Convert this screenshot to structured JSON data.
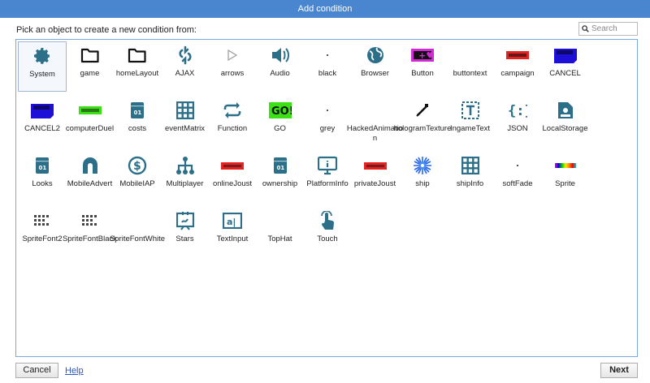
{
  "dialog": {
    "title": "Add condition",
    "prompt": "Pick an object to create a new condition from:",
    "search_placeholder": "Search"
  },
  "objects": [
    {
      "label": "System",
      "icon": "gear-icon",
      "selected": true
    },
    {
      "label": "game",
      "icon": "folder-icon"
    },
    {
      "label": "homeLayout",
      "icon": "folder-icon"
    },
    {
      "label": "AJAX",
      "icon": "ajax-icon"
    },
    {
      "label": "arrows",
      "icon": "play-triangle-icon"
    },
    {
      "label": "Audio",
      "icon": "speaker-icon"
    },
    {
      "label": "black",
      "icon": "dot-icon"
    },
    {
      "label": "Browser",
      "icon": "globe-icon"
    },
    {
      "label": "Button",
      "icon": "button-sprite-icon"
    },
    {
      "label": "buttontext",
      "icon": "blank-icon"
    },
    {
      "label": "campaign",
      "icon": "campaign-sprite-icon"
    },
    {
      "label": "CANCEL",
      "icon": "cancel-sprite-icon"
    },
    {
      "label": "CANCEL2",
      "icon": "cancel-sprite-icon"
    },
    {
      "label": "computerDuel",
      "icon": "green-banner-icon"
    },
    {
      "label": "costs",
      "icon": "array-book-icon"
    },
    {
      "label": "eventMatrix",
      "icon": "grid-icon"
    },
    {
      "label": "Function",
      "icon": "repeat-arrows-icon"
    },
    {
      "label": "GO",
      "icon": "go-sprite-icon"
    },
    {
      "label": "grey",
      "icon": "dot-icon"
    },
    {
      "label": "HackedAnimation",
      "icon": "blank-icon"
    },
    {
      "label": "hologramTexture",
      "icon": "hologram-icon"
    },
    {
      "label": "IngameText",
      "icon": "text-box-icon"
    },
    {
      "label": "JSON",
      "icon": "json-braces-icon"
    },
    {
      "label": "LocalStorage",
      "icon": "local-storage-icon"
    },
    {
      "label": "Looks",
      "icon": "array-book-icon"
    },
    {
      "label": "MobileAdvert",
      "icon": "mobile-advert-icon"
    },
    {
      "label": "MobileIAP",
      "icon": "dollar-icon"
    },
    {
      "label": "Multiplayer",
      "icon": "network-tree-icon"
    },
    {
      "label": "onlineJoust",
      "icon": "red-banner-icon"
    },
    {
      "label": "ownership",
      "icon": "array-book-icon"
    },
    {
      "label": "PlatformInfo",
      "icon": "monitor-info-icon"
    },
    {
      "label": "privateJoust",
      "icon": "red-banner-icon"
    },
    {
      "label": "ship",
      "icon": "ship-burst-icon"
    },
    {
      "label": "shipInfo",
      "icon": "grid-icon"
    },
    {
      "label": "softFade",
      "icon": "dot-icon"
    },
    {
      "label": "Sprite",
      "icon": "rainbow-sprite-icon"
    },
    {
      "label": "SpriteFont2",
      "icon": "sprite-font-icon"
    },
    {
      "label": "SpriteFontBlack",
      "icon": "sprite-font-icon"
    },
    {
      "label": "SpriteFontWhite",
      "icon": "blank-icon"
    },
    {
      "label": "Stars",
      "icon": "stars-icon"
    },
    {
      "label": "TextInput",
      "icon": "text-input-icon"
    },
    {
      "label": "TopHat",
      "icon": "blank-icon"
    },
    {
      "label": "Touch",
      "icon": "touch-hand-icon"
    }
  ],
  "footer": {
    "cancel_label": "Cancel",
    "help_label": "Help",
    "next_label": "Next"
  },
  "colors": {
    "titlebar": "#4a86d0",
    "icon_teal": "#2b6f89",
    "panel_border": "#7aa7dc"
  }
}
